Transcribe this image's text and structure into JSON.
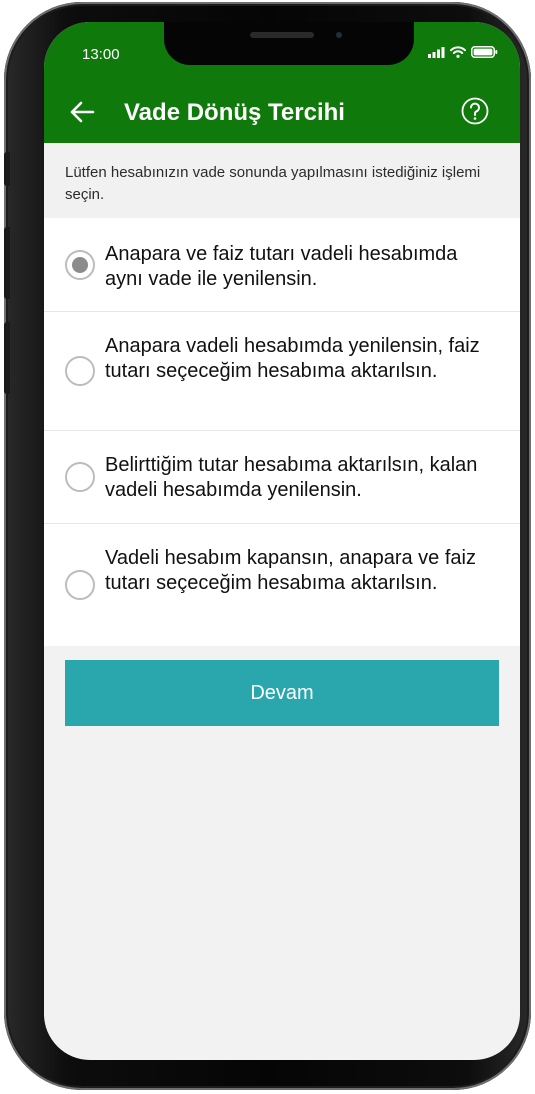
{
  "status_bar": {
    "time": "13:00",
    "icons": [
      "signal-icon",
      "wifi-icon",
      "battery-icon"
    ]
  },
  "header": {
    "title": "Vade Dönüş Tercihi",
    "back_icon": "arrow-left-icon",
    "help_icon": "question-circle-icon"
  },
  "intro": {
    "text": "Lütfen hesabınızın vade sonunda yapılmasını istediğiniz işlemi seçin."
  },
  "options": [
    {
      "label": "Anapara ve faiz tutarı vadeli hesabımda aynı vade ile yenilensin.",
      "selected": true
    },
    {
      "label": "Anapara vadeli hesabımda yenilensin, faiz tutarı seçeceğim hesabıma aktarılsın.",
      "selected": false
    },
    {
      "label": "Belirttiğim tutar hesabıma aktarılsın, kalan vadeli hesabımda yenilensin.",
      "selected": false
    },
    {
      "label": "Vadeli hesabım kapansın, anapara ve faiz tutarı seçeceğim hesabıma aktarılsın.",
      "selected": false
    }
  ],
  "continue_button": {
    "label": "Devam"
  },
  "colors": {
    "header_green": "#0f7a0b",
    "button_teal": "#2aa7ac",
    "radio_selected": "#8c8c8c",
    "background": "#f2f2f2"
  }
}
